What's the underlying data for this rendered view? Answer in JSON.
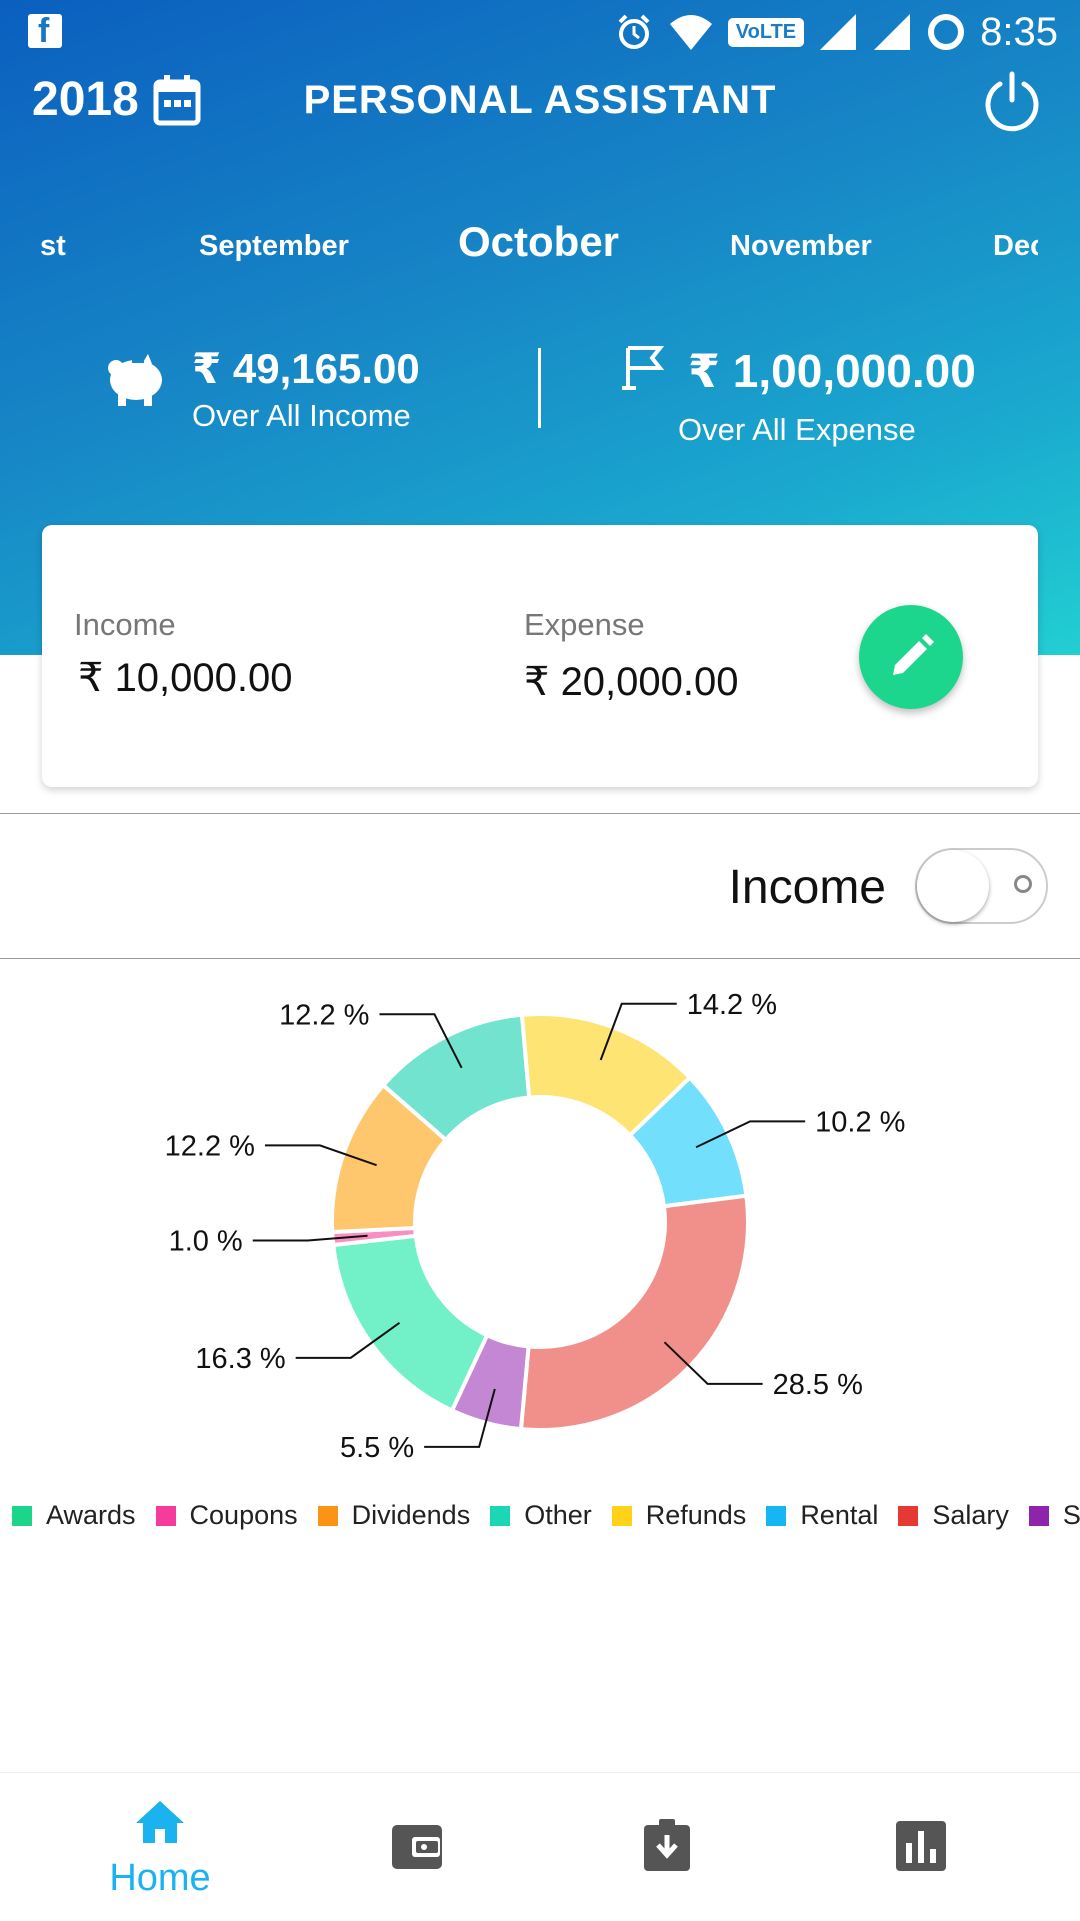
{
  "status_bar": {
    "time": "8:35",
    "network_badge": "VoLTE",
    "icons": [
      "facebook-icon",
      "alarm-icon",
      "wifi-icon",
      "volte-icon",
      "signal-icon",
      "signal-icon",
      "battery-saver-icon"
    ]
  },
  "header": {
    "year": "2018",
    "title": "PERSONAL ASSISTANT",
    "months": [
      "st",
      "September",
      "October",
      "November",
      "Dec"
    ],
    "active_month": "October"
  },
  "summary": {
    "income_amount": "₹ 49,165.00",
    "income_label": "Over All Income",
    "expense_amount": "₹ 1,00,000.00",
    "expense_label": "Over All Expense"
  },
  "month_card": {
    "income_label": "Income",
    "income_value": "₹ 10,000.00",
    "expense_label": "Expense",
    "expense_value": "₹ 20,000.00"
  },
  "toggle": {
    "label": "Income",
    "state": "off"
  },
  "chart_data": {
    "type": "pie",
    "donut": true,
    "slices": [
      {
        "category": "Refunds",
        "value": 14.2,
        "label": "14.2 %",
        "color": "#fde473"
      },
      {
        "category": "Rental",
        "value": 10.2,
        "label": "10.2 %",
        "color": "#72dffd"
      },
      {
        "category": "Salary",
        "value": 28.5,
        "label": "28.5 %",
        "color": "#f1908b"
      },
      {
        "category": "Sales",
        "value": 5.5,
        "label": "5.5 %",
        "color": "#c387d4"
      },
      {
        "category": "Awards",
        "value": 16.3,
        "label": "16.3 %",
        "color": "#72f1c8"
      },
      {
        "category": "Coupons",
        "value": 1.0,
        "label": "1.0 %",
        "color": "#f78fc1"
      },
      {
        "category": "Dividends",
        "value": 12.2,
        "label": "12.2 %",
        "color": "#fec76e"
      },
      {
        "category": "Other",
        "value": 12.2,
        "label": "12.2 %",
        "color": "#72e3cf"
      }
    ],
    "legend": [
      {
        "name": "Awards",
        "color": "#1bd68a"
      },
      {
        "name": "Coupons",
        "color": "#f53c9a"
      },
      {
        "name": "Dividends",
        "color": "#fb9314"
      },
      {
        "name": "Other",
        "color": "#1dd6b4"
      },
      {
        "name": "Refunds",
        "color": "#ffd21a"
      },
      {
        "name": "Rental",
        "color": "#16b6f5"
      },
      {
        "name": "Salary",
        "color": "#e53935"
      },
      {
        "name": "Sales",
        "color": "#8e24aa"
      }
    ],
    "legend_position": "bottom"
  },
  "bottom_nav": {
    "items": [
      {
        "label": "Home",
        "icon": "home-icon",
        "active": true
      },
      {
        "label": "",
        "icon": "wallet-icon",
        "active": false
      },
      {
        "label": "",
        "icon": "download-clipboard-icon",
        "active": false
      },
      {
        "label": "",
        "icon": "bar-chart-icon",
        "active": false
      }
    ],
    "active_color": "#1ab3f0",
    "inactive_color": "#555555"
  }
}
